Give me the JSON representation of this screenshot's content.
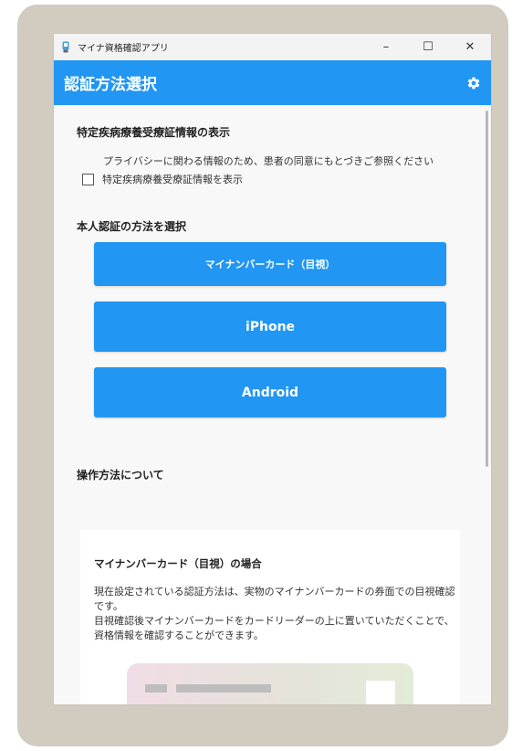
{
  "window": {
    "title": "マイナ資格確認アプリ",
    "minimize_glyph": "–",
    "maximize_glyph": "☐",
    "close_glyph": "✕",
    "app_icon": "app-icon"
  },
  "header": {
    "title": "認証方法選択",
    "settings_icon": "gear-icon"
  },
  "special_disease": {
    "title": "特定疾病療養受療証情報の表示",
    "note": "プライバシーに関わる情報のため、患者の同意にもとづきご参照ください",
    "checkbox_label": "特定疾病療養受療証情報を表示",
    "checked": false
  },
  "auth_method": {
    "title": "本人認証の方法を選択",
    "buttons": [
      {
        "label": "マイナンバーカード（目視）"
      },
      {
        "label": "iPhone"
      },
      {
        "label": "Android"
      }
    ]
  },
  "operation": {
    "title": "操作方法について",
    "card_title": "マイナンバーカード（目視）の場合",
    "card_body": "現在設定されている認証方法は、実物のマイナンバーカードの券面での目視確認です。\n目視確認後マイナンバーカードをカードリーダーの上に置いていただくことで、資格情報を確認することができます。"
  },
  "colors": {
    "accent": "#2196f3",
    "frame": "#d1cbc0",
    "window_bg": "#f8f8f8"
  }
}
